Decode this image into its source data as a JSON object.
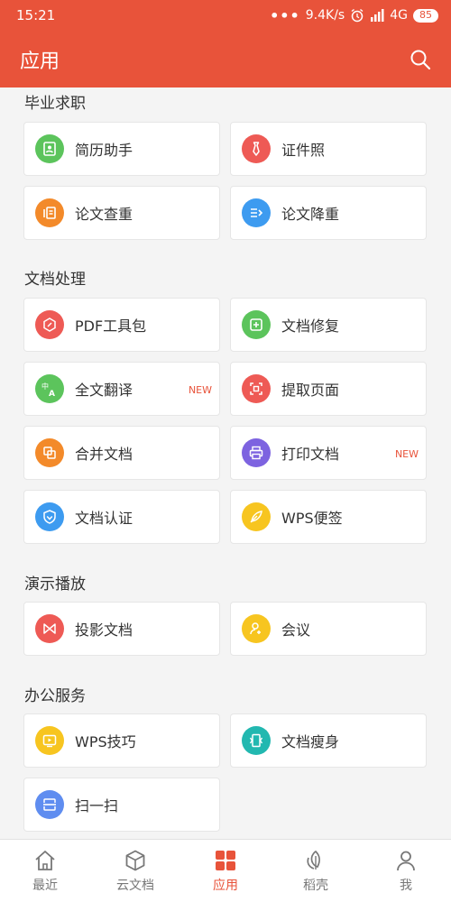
{
  "status": {
    "time": "15:21",
    "dots": "•••",
    "speed": "9.4K/s",
    "network": "4G",
    "battery": "85"
  },
  "header": {
    "title": "应用"
  },
  "sections": {
    "graduate": {
      "title": "毕业求职"
    },
    "docs": {
      "title": "文档处理"
    },
    "present": {
      "title": "演示播放"
    },
    "office": {
      "title": "办公服务"
    }
  },
  "items": {
    "resume": "简历助手",
    "idphoto": "证件照",
    "plagiarism": "论文查重",
    "rewrite": "论文降重",
    "pdf": "PDF工具包",
    "repair": "文档修复",
    "translate": "全文翻译",
    "extract": "提取页面",
    "merge": "合并文档",
    "print": "打印文档",
    "certify": "文档认证",
    "notes": "WPS便签",
    "project": "投影文档",
    "meeting": "会议",
    "tips": "WPS技巧",
    "slim": "文档瘦身",
    "scan": "扫一扫"
  },
  "badges": {
    "new": "NEW"
  },
  "tabs": {
    "recent": "最近",
    "cloud": "云文档",
    "apps": "应用",
    "shell": "稻壳",
    "me": "我"
  },
  "colors": {
    "accent": "#e8533a",
    "green": "#5cc45c",
    "red": "#ee5a55",
    "orange": "#f38a2a",
    "blue": "#3d9bf0",
    "purple": "#7d63e0",
    "yellow": "#f7c520",
    "teal": "#22b8b0",
    "lightblue": "#5f8df0"
  }
}
